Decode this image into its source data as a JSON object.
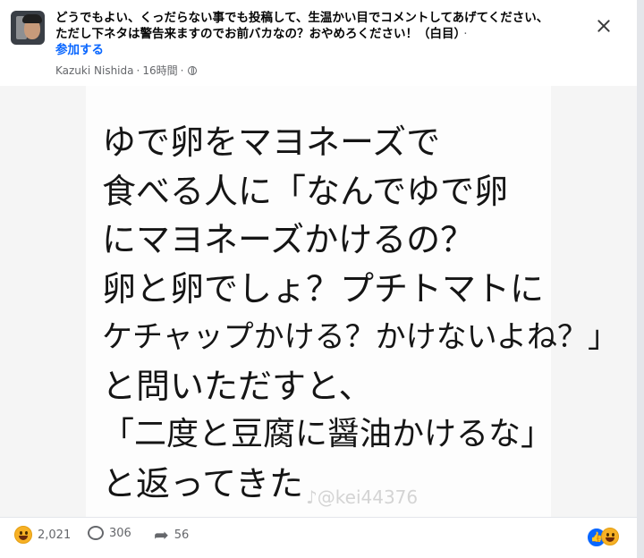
{
  "post": {
    "group_title": "どうでもよい、くっだらない事でも投稿して、生温かい目でコメントしてあげてください、ただし下ネタは警告来ますのでお前バカなの？おやめろください！（白目）",
    "join_label": "参加する",
    "separator": "·",
    "author": "Kazuki Nishida",
    "time": "16時間",
    "privacy_icon": "globe-icon"
  },
  "image": {
    "lines": [
      "ゆで卵をマヨネーズで",
      "食べる人に「なんでゆで卵",
      "にマヨネーズかけるの？",
      "卵と卵でしょ？プチトマトに",
      "ケチャップかける？かけないよね？」",
      "と問いただすと、",
      "「二度と豆腐に醤油かけるな」",
      "と返ってきた"
    ],
    "watermark": "♪@kei44376"
  },
  "footer": {
    "reactions_count": "2,021",
    "comments_count": "306",
    "shares_count": "56"
  },
  "colors": {
    "accent": "#0866ff",
    "text": "#050505",
    "muted": "#65676b"
  }
}
